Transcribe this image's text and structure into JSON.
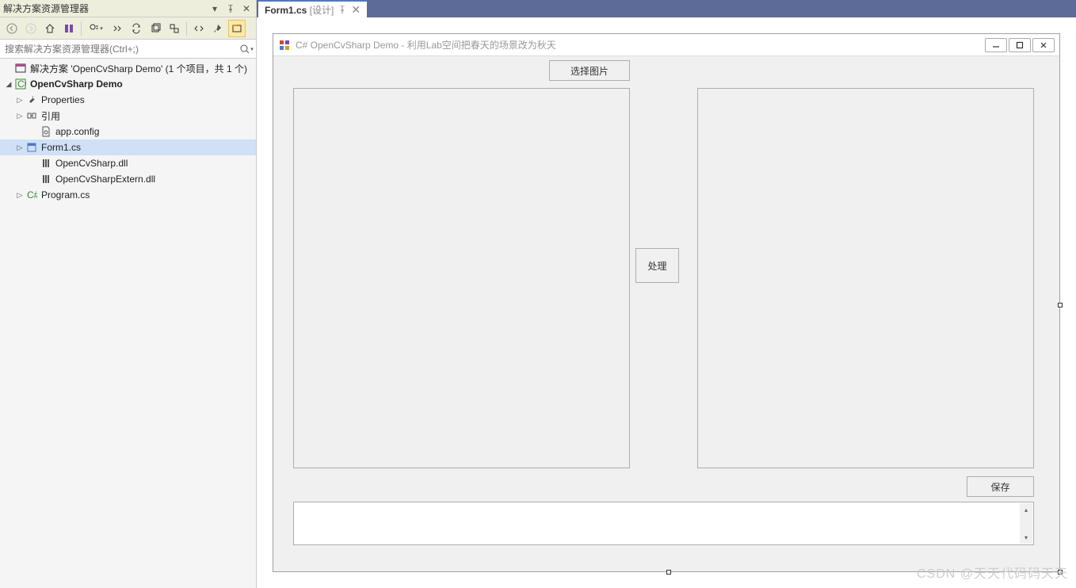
{
  "solution_explorer": {
    "title": "解决方案资源管理器",
    "search_placeholder": "搜索解决方案资源管理器(Ctrl+;)",
    "tree": {
      "solution": "解决方案 'OpenCvSharp Demo' (1 个项目，共 1 个)",
      "project": "OpenCvSharp Demo",
      "properties": "Properties",
      "references": "引用",
      "app_config": "app.config",
      "form1": "Form1.cs",
      "opencv_dll": "OpenCvSharp.dll",
      "opencv_extern_dll": "OpenCvSharpExtern.dll",
      "program": "Program.cs"
    }
  },
  "tab": {
    "title": "Form1.cs",
    "subtitle": "[设计]"
  },
  "winform": {
    "title": "C# OpenCvSharp Demo - 利用Lab空间把春天的场景改为秋天",
    "select_image_btn": "选择图片",
    "process_btn": "处理",
    "save_btn": "保存"
  },
  "watermark": "CSDN @天天代码码天天"
}
